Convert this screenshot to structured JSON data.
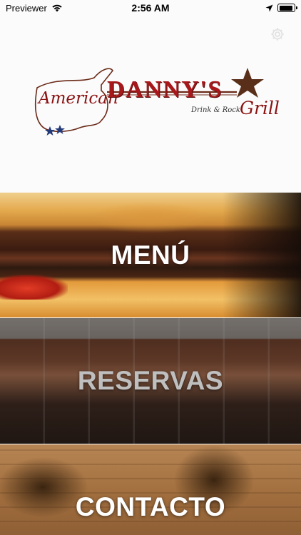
{
  "status_bar": {
    "carrier": "Previewer",
    "time": "2:56 AM",
    "battery_level": 0.9
  },
  "header": {
    "settings_icon": "gear-icon",
    "logo": {
      "american": "American",
      "name": "DANNY'S",
      "tagline": "Drink & Rock",
      "grill": "Grill"
    }
  },
  "tiles": [
    {
      "label": "MENÚ"
    },
    {
      "label": "RESERVAS"
    },
    {
      "label": "CONTACTO"
    }
  ],
  "colors": {
    "brand_red": "#a8181b",
    "brand_brown": "#5a2f1a",
    "star_blue": "#233a7a"
  }
}
